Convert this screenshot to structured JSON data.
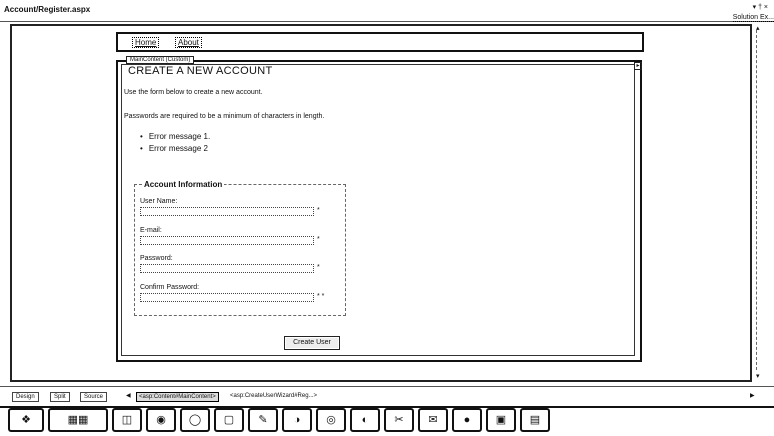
{
  "window": {
    "tab_title": "Account/Register.aspx",
    "controls": "▾ † ×",
    "solution_explorer_label": "Solution Ex..."
  },
  "master": {
    "links": [
      "Home",
      "About"
    ]
  },
  "content": {
    "placeholder_tag": "MainContent (Custom)",
    "smart_tag": "▸",
    "title": "Create a New Account",
    "intro": "Use the form below to create a new account.",
    "password_note": "Passwords are required to be a minimum of characters in length.",
    "errors": [
      "Error message 1.",
      "Error message 2"
    ],
    "legend": "Account Information",
    "fields": [
      {
        "label": "User Name:",
        "req": "*"
      },
      {
        "label": "E-mail:",
        "req": "*"
      },
      {
        "label": "Password:",
        "req": "*"
      },
      {
        "label": "Confirm Password:",
        "req": "* *"
      }
    ],
    "submit_label": "Create User"
  },
  "view_bar": {
    "design": "Design",
    "split": "Split",
    "source": "Source",
    "crumbs": [
      "<asp:Content#MainContent>",
      "<asp:CreateUserWizard#Reg...>"
    ]
  },
  "taskbar": {
    "icons": [
      "start-orb-icon",
      "explorer-icon",
      "media-icon",
      "calendar-icon",
      "chrome-icon",
      "firefox-icon",
      "notepad-icon",
      "word-icon",
      "paint-icon",
      "folder-icon",
      "skype-icon",
      "vs-icon",
      "snipping-icon",
      "outlook-icon",
      "remote-icon"
    ]
  }
}
